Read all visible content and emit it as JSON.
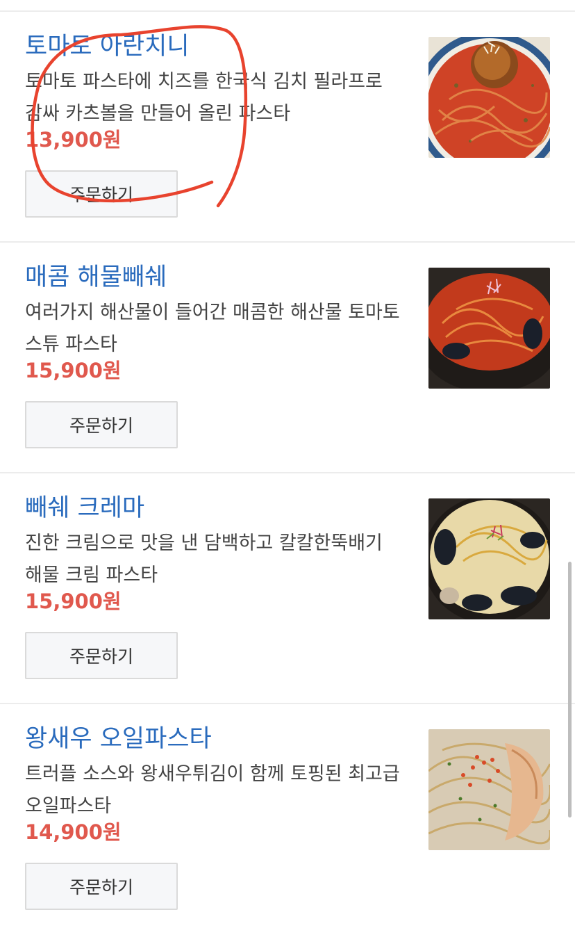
{
  "menu": {
    "items": [
      {
        "name": "토마토 아란치니",
        "desc_line1": "토마토 파스타에 치즈를 한국식 김치 필라프로",
        "desc_line2": "감싸 카츠볼을 만들어 올린 파스타",
        "price": "13,900원",
        "order_label": "주문하기",
        "photo_icon": "tomato-arancini-pasta-photo"
      },
      {
        "name": "매콤 해물빼쉐",
        "desc_line1": "여러가지 해산물이 들어간 매콤한 해산물 토마토",
        "desc_line2": "스튜 파스타",
        "price": "15,900원",
        "order_label": "주문하기",
        "photo_icon": "spicy-seafood-stew-photo"
      },
      {
        "name": "빼쉐 크레마",
        "desc_line1": "진한 크림으로 맛을 낸 담백하고 칼칼한뚝배기",
        "desc_line2": "해물 크림 파스타",
        "price": "15,900원",
        "order_label": "주문하기",
        "photo_icon": "seafood-cream-pasta-photo"
      },
      {
        "name": "왕새우 오일파스타",
        "desc_line1": "트러플 소스와 왕새우튀김이 함께 토핑된 최고급",
        "desc_line2": "오일파스타",
        "price": "14,900원",
        "order_label": "주문하기",
        "photo_icon": "king-prawn-oil-pasta-photo"
      }
    ]
  },
  "colors": {
    "name": "#2a6bbd",
    "price": "#e0584d",
    "annotation": "#e8432e"
  }
}
